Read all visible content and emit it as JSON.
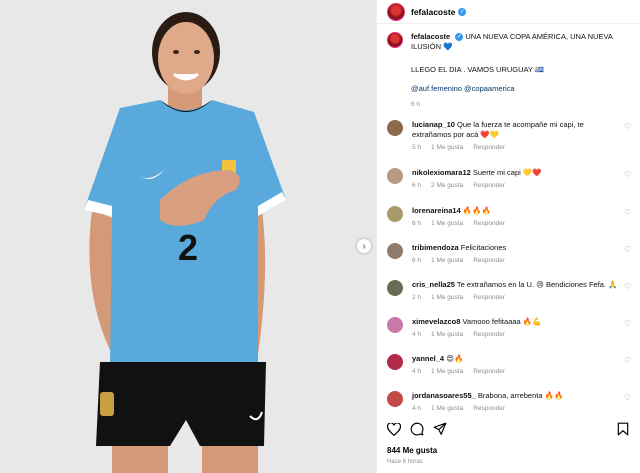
{
  "post": {
    "username": "fefalacoste",
    "caption_username": "fefalacoste",
    "caption_line1": "UNA NUEVA COPA AMÉRICA, UNA NUEVA ILUSIÓN 💙",
    "caption_line2": "LLEGO EL DIA . VAMOS URUGUAY 🇺🇾",
    "caption_tags": "@auf.femenino @copaamerica",
    "caption_time": "6 h",
    "likes": "844 Me gusta",
    "posted_ago": "Hace 6 horas"
  },
  "photo": {
    "jersey_number": "2"
  },
  "comments": [
    {
      "user": "lucianap_10",
      "text": "Que la fuerza te acompañe mi capi, te extrañamos por acá ❤️💛",
      "time": "5 h",
      "likes": "1 Me gusta",
      "reply": "Responder",
      "avatar_color": "#8a6a4a"
    },
    {
      "user": "nikolexiomara12",
      "text": "Suerte mi capi 💛❤️",
      "time": "6 h",
      "likes": "2 Me gusta",
      "reply": "Responder",
      "avatar_color": "#b59b86"
    },
    {
      "user": "lorenareina14",
      "text": "🔥🔥🔥",
      "time": "6 h",
      "likes": "1 Me gusta",
      "reply": "Responder",
      "avatar_color": "#a89b6a"
    },
    {
      "user": "tribimendoza",
      "text": "Felicitaciones",
      "time": "6 h",
      "likes": "1 Me gusta",
      "reply": "Responder",
      "avatar_color": "#8f7b6b"
    },
    {
      "user": "cris_nella25",
      "text": "Te extrañamos en la U. 😢 Bendiciones Fefa. 🙏",
      "time": "2 h",
      "likes": "1 Me gusta",
      "reply": "Responder",
      "avatar_color": "#6b6b55"
    },
    {
      "user": "ximevelazco8",
      "text": "Vamooo fefitaaaa 🔥💪",
      "time": "4 h",
      "likes": "1 Me gusta",
      "reply": "Responder",
      "avatar_color": "#c77aa8"
    },
    {
      "user": "yannel_4",
      "text": "😍🔥",
      "time": "4 h",
      "likes": "1 Me gusta",
      "reply": "Responder",
      "avatar_color": "#b22a4a"
    },
    {
      "user": "jordanasoares55_",
      "text": "Brabona, arrebenta 🔥🔥",
      "time": "4 h",
      "likes": "1 Me gusta",
      "reply": "Responder",
      "avatar_color": "#c44a4a"
    }
  ],
  "icons": {
    "like": "heart-icon",
    "comment": "comment-icon",
    "share": "share-icon",
    "save": "bookmark-icon",
    "next": "chevron-right-icon"
  },
  "colors": {
    "jersey": "#5aa9dc",
    "link": "#00376b",
    "verified": "#3897f0",
    "meta": "#8e8e8e"
  }
}
